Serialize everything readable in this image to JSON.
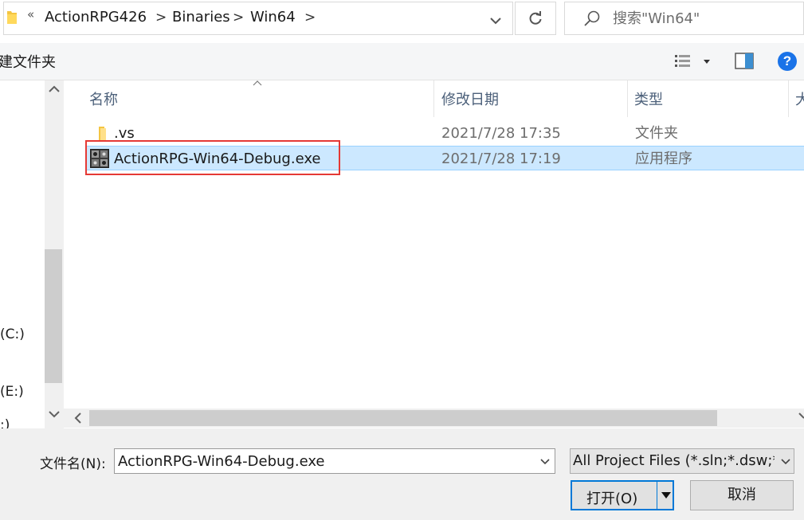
{
  "address_bar": {
    "overflow_label": "«",
    "breadcrumbs": [
      "ActionRPG426",
      "Binaries",
      "Win64"
    ],
    "separator": ">",
    "search_placeholder": "搜索\"Win64\""
  },
  "toolbar": {
    "new_folder_label": "建文件夹",
    "icons": [
      "view-options-icon",
      "preview-pane-icon",
      "help-icon"
    ],
    "help_label": "?"
  },
  "nav_pane": {
    "drives": [
      "(C:)",
      "(E:)",
      ":)"
    ]
  },
  "file_list": {
    "columns": [
      "名称",
      "修改日期",
      "类型",
      "大"
    ],
    "rows": [
      {
        "name": ".vs",
        "date": "2021/7/28 17:35",
        "type": "文件夹",
        "icon": "folder-icon",
        "selected": false
      },
      {
        "name": "ActionRPG-Win64-Debug.exe",
        "date": "2021/7/28 17:19",
        "type": "应用程序",
        "icon": "exe-icon",
        "selected": true
      }
    ],
    "highlight_color": "#e53935",
    "selection_color": "#cce8ff"
  },
  "bottom": {
    "filename_label": "文件名(N):",
    "filename_value": "ActionRPG-Win64-Debug.exe",
    "filter_value": "All Project Files (*.sln;*.dsw;*.v",
    "open_label": "打开(O)",
    "cancel_label": "取消"
  }
}
